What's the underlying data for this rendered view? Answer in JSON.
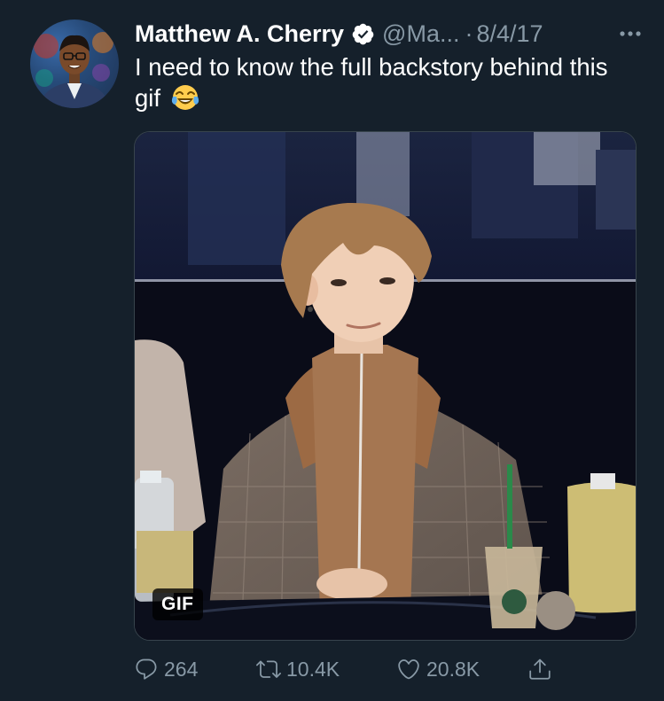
{
  "tweet": {
    "author_name": "Matthew A. Cherry",
    "handle": "@Ma...",
    "separator": "·",
    "date": "8/4/17",
    "text": "I need to know the full backstory behind this gif",
    "emoji": "face-with-tears-of-joy",
    "media": {
      "badge": "GIF"
    },
    "stats": {
      "replies": "264",
      "retweets": "10.4K",
      "likes": "20.8K"
    }
  },
  "colors": {
    "background": "#15202b",
    "secondary_text": "#8899a6",
    "verified": "#ffffff",
    "border": "#38444d"
  }
}
